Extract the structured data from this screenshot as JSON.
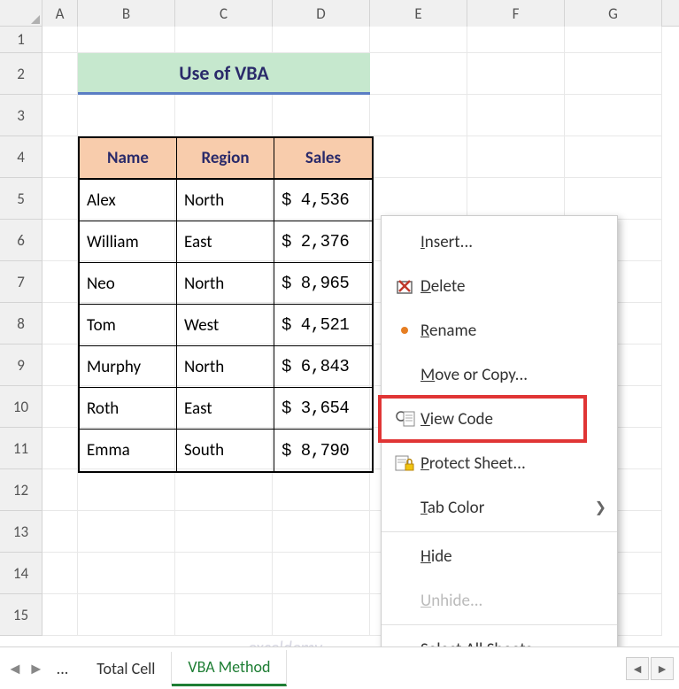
{
  "columns": [
    "A",
    "B",
    "C",
    "D",
    "E",
    "F",
    "G"
  ],
  "row_numbers": [
    1,
    2,
    3,
    4,
    5,
    6,
    7,
    8,
    9,
    10,
    11,
    12,
    13,
    14,
    15
  ],
  "title": "Use of VBA",
  "table": {
    "headers": [
      "Name",
      "Region",
      "Sales"
    ],
    "rows": [
      {
        "name": "Alex",
        "region": "North",
        "sales": "$  4,536"
      },
      {
        "name": "William",
        "region": "East",
        "sales": "$  2,376"
      },
      {
        "name": "Neo",
        "region": "North",
        "sales": "$  8,965"
      },
      {
        "name": "Tom",
        "region": "West",
        "sales": "$  4,521"
      },
      {
        "name": "Murphy",
        "region": "North",
        "sales": "$  6,843"
      },
      {
        "name": "Roth",
        "region": "East",
        "sales": "$  3,654"
      },
      {
        "name": "Emma",
        "region": "South",
        "sales": "$  8,790"
      }
    ]
  },
  "context_menu": {
    "items": [
      {
        "label": "Insert...",
        "icon": "",
        "accel": "I"
      },
      {
        "label": "Delete",
        "icon": "delete",
        "accel": "D"
      },
      {
        "label": "Rename",
        "icon": "dot",
        "accel": "R"
      },
      {
        "label": "Move or Copy...",
        "icon": "",
        "accel": "M"
      },
      {
        "label": "View Code",
        "icon": "viewcode",
        "accel": "V"
      },
      {
        "label": "Protect Sheet...",
        "icon": "protect",
        "accel": "P"
      },
      {
        "label": "Tab Color",
        "icon": "",
        "arrow": true,
        "accel": "T"
      },
      {
        "label": "Hide",
        "icon": "",
        "accel": "H"
      },
      {
        "label": "Unhide...",
        "icon": "",
        "disabled": true,
        "accel": "U"
      },
      {
        "label": "Select All Sheets",
        "icon": "",
        "accel": "S"
      }
    ]
  },
  "sheet_tabs": {
    "ellipsis": "...",
    "tabs": [
      {
        "label": "Total Cell",
        "active": false
      },
      {
        "label": "VBA Method",
        "active": true
      }
    ]
  },
  "watermark": "exceldemy"
}
